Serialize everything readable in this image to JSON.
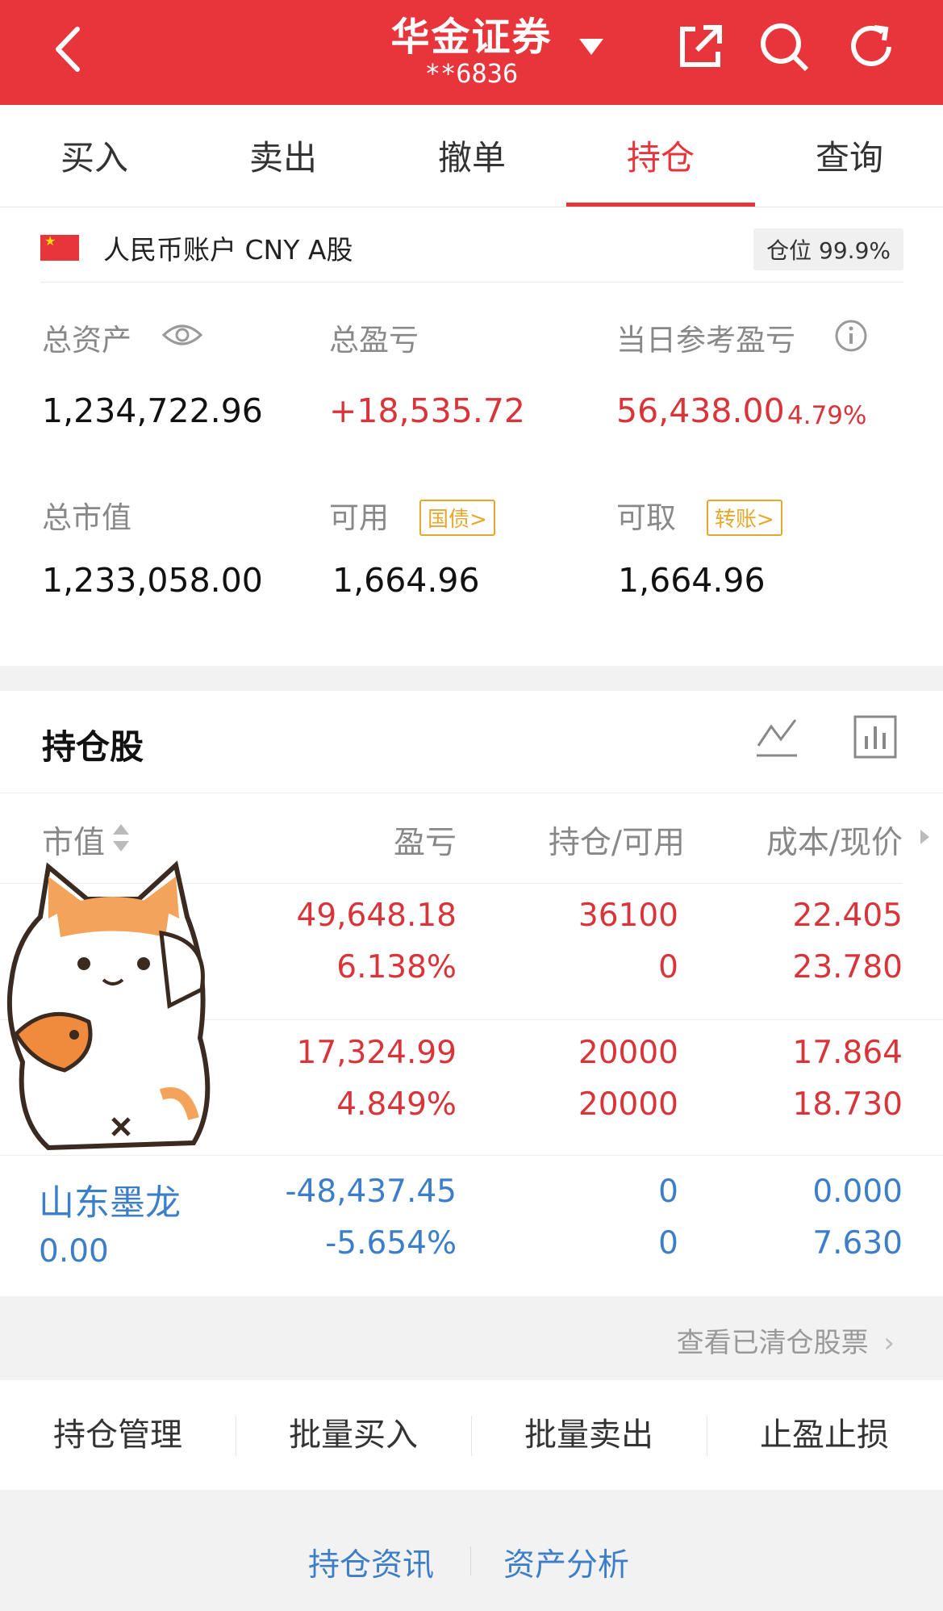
{
  "header": {
    "title": "华金证券",
    "account_masked": "**6836",
    "colors": {
      "brand": "#e8353b",
      "text": "#ffffff"
    },
    "icons": [
      "back-arrow-icon",
      "dropdown-caret-icon",
      "share-icon",
      "search-icon",
      "refresh-icon"
    ]
  },
  "tabs": [
    {
      "label": "买入"
    },
    {
      "label": "卖出"
    },
    {
      "label": "撤单"
    },
    {
      "label": "持仓",
      "active": true
    },
    {
      "label": "查询"
    }
  ],
  "account": {
    "label": "人民币账户 CNY A股",
    "position_ratio": "仓位 99.9%"
  },
  "summary": {
    "total_assets_label": "总资产",
    "total_assets": "1,234,722.96",
    "total_pnl_label": "总盈亏",
    "total_pnl": "+18,535.72",
    "daily_pnl_label": "当日参考盈亏",
    "daily_pnl": "56,438.00",
    "daily_pnl_pct": "4.79%",
    "market_value_label": "总市值",
    "market_value": "1,233,058.00",
    "available_label": "可用",
    "available_tag": "国债>",
    "available": "1,664.96",
    "withdrawable_label": "可取",
    "withdrawable_tag": "转账>",
    "withdrawable": "1,664.96"
  },
  "holdings": {
    "title": "持仓股",
    "columns": [
      "市值",
      "盈亏",
      "持仓/可用",
      "成本/现价"
    ],
    "rows": [
      {
        "name": "",
        "market_value": "",
        "pnl": "49,648.18",
        "pnl_pct": "6.138%",
        "position": "36100",
        "available": "0",
        "cost": "22.405",
        "price": "23.780",
        "color": "red"
      },
      {
        "name": "",
        "market_value": "",
        "pnl": "17,324.99",
        "pnl_pct": "4.849%",
        "position": "20000",
        "available": "20000",
        "cost": "17.864",
        "price": "18.730",
        "color": "red"
      },
      {
        "name": "山东墨龙",
        "market_value": "0.00",
        "pnl": "-48,437.45",
        "pnl_pct": "-5.654%",
        "position": "0",
        "available": "0",
        "cost": "0.000",
        "price": "7.630",
        "color": "blue"
      }
    ],
    "cleared_link": "查看已清仓股票"
  },
  "actions": [
    "持仓管理",
    "批量买入",
    "批量卖出",
    "止盈止损"
  ],
  "footer": {
    "news": "持仓资讯",
    "analysis": "资产分析"
  }
}
